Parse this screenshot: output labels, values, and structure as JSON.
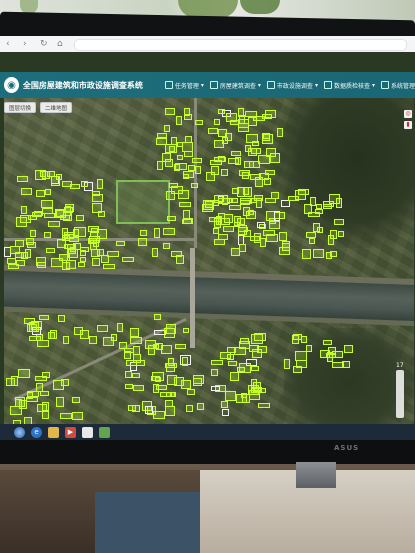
{
  "window": {
    "app_title": "全国房屋建筑和市政设施调查系统"
  },
  "menu": [
    {
      "label": "任务管理"
    },
    {
      "label": "房屋建筑调查"
    },
    {
      "label": "市政设施调查"
    },
    {
      "label": "数据质检核查"
    },
    {
      "label": "系统管理"
    }
  ],
  "toolbar": {
    "btn1": "图层切换",
    "btn2": "二维地图"
  },
  "map": {
    "zoom_level": "17"
  },
  "monitor": {
    "brand": "ASUS"
  },
  "colors": {
    "header": "#1d6e7c",
    "building_outline": "#c8ff2e"
  }
}
